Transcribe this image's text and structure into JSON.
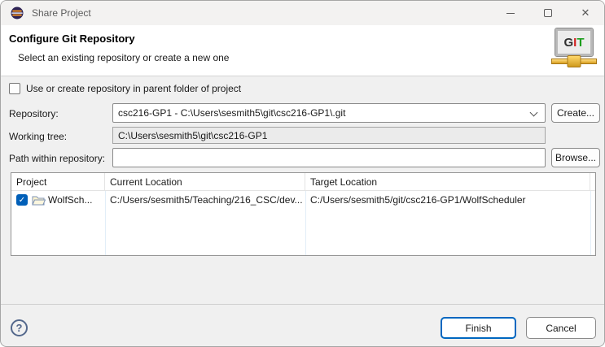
{
  "window": {
    "title": "Share Project"
  },
  "icons": {
    "close": "✕",
    "check": "✓",
    "help": "?"
  },
  "header": {
    "title": "Configure Git Repository",
    "subtitle": "Select an existing repository or create a new one",
    "git_letters": {
      "g": "G",
      "i": "I",
      "t": "T"
    }
  },
  "form": {
    "parent_checkbox_label": "Use or create repository in parent folder of project",
    "parent_checkbox_checked": false,
    "repository": {
      "label": "Repository:",
      "value": "csc216-GP1 - C:\\Users\\sesmith5\\git\\csc216-GP1\\.git",
      "create_button": "Create..."
    },
    "working_tree": {
      "label": "Working tree:",
      "value": "C:\\Users\\sesmith5\\git\\csc216-GP1"
    },
    "path_within_repository": {
      "label": "Path within repository:",
      "value": "",
      "browse_button": "Browse..."
    }
  },
  "table": {
    "columns": [
      "Project",
      "Current Location",
      "Target Location"
    ],
    "rows": [
      {
        "checked": true,
        "project": "WolfSch...",
        "current_location": "C:/Users/sesmith5/Teaching/216_CSC/dev...",
        "target_location": "C:/Users/sesmith5/git/csc216-GP1/WolfScheduler"
      }
    ]
  },
  "footer": {
    "finish_button": "Finish",
    "cancel_button": "Cancel"
  },
  "colors": {
    "accent": "#0067c0",
    "checkbox_checked": "#005fb8",
    "body_bg": "#f0f0f0",
    "header_bg": "#ffffff",
    "eclipse_navy": "#2c2255",
    "eclipse_orange": "#f7941e",
    "git_gold": "#d89e1e"
  }
}
